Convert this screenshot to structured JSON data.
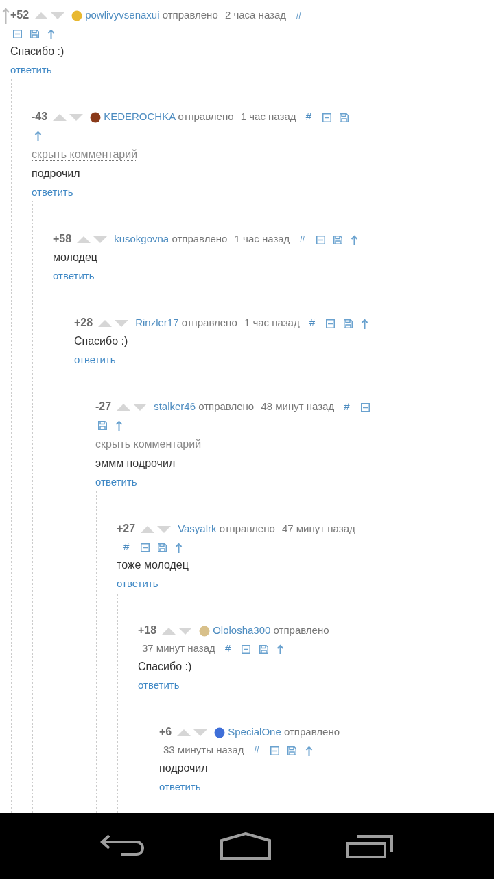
{
  "comments": [
    {
      "parent_arrow": true,
      "score": "+52",
      "avatar": true,
      "user": "powlivyvsenaxui",
      "sent": "отправлено",
      "time": "2 часа назад",
      "anchor": "#",
      "text": "Спасибо :)",
      "reply": "ответить",
      "children": [
        {
          "parent_arrow": false,
          "score": "-43",
          "avatar": true,
          "user": "KEDEROCHKA",
          "sent": "отправлено",
          "time": "1 час назад",
          "anchor": "#",
          "hide_link": "скрыть комментарий",
          "text": "подрочил",
          "reply": "ответить",
          "children": [
            {
              "parent_arrow": false,
              "score": "+58",
              "avatar": false,
              "user": "kusokgovna",
              "sent": "отправлено",
              "time": "1 час назад",
              "anchor": "#",
              "text": "молодец",
              "reply": "ответить",
              "children": [
                {
                  "parent_arrow": false,
                  "score": "+28",
                  "avatar": false,
                  "user": "Rinzler17",
                  "sent": "отправлено",
                  "time": "1 час назад",
                  "anchor": "#",
                  "text": "Спасибо :)",
                  "reply": "ответить",
                  "children": [
                    {
                      "parent_arrow": false,
                      "score": "-27",
                      "avatar": false,
                      "user": "stalker46",
                      "sent": "отправлено",
                      "time": "48 минут назад",
                      "anchor": "#",
                      "hide_link": "скрыть комментарий",
                      "text": "эммм подрочил",
                      "reply": "ответить",
                      "children": [
                        {
                          "parent_arrow": false,
                          "score": "+27",
                          "avatar": false,
                          "user": "Vasyalrk",
                          "sent": "отправлено",
                          "time": "47 минут назад",
                          "anchor": "#",
                          "text": "тоже молодец",
                          "reply": "ответить",
                          "children": [
                            {
                              "parent_arrow": false,
                              "score": "+18",
                              "avatar": true,
                              "user": "Ololosha300",
                              "sent": "отправлено",
                              "time": "37 минут назад",
                              "anchor": "#",
                              "text": "Спасибо :)",
                              "reply": "ответить",
                              "children": [
                                {
                                  "parent_arrow": false,
                                  "score": "+6",
                                  "avatar": true,
                                  "user": "SpecialOne",
                                  "sent": "отправлено",
                                  "time": "33 минуты назад",
                                  "anchor": "#",
                                  "text": "подрочил",
                                  "reply": "ответить"
                                }
                              ]
                            }
                          ]
                        }
                      ]
                    }
                  ]
                }
              ]
            }
          ]
        }
      ]
    }
  ]
}
